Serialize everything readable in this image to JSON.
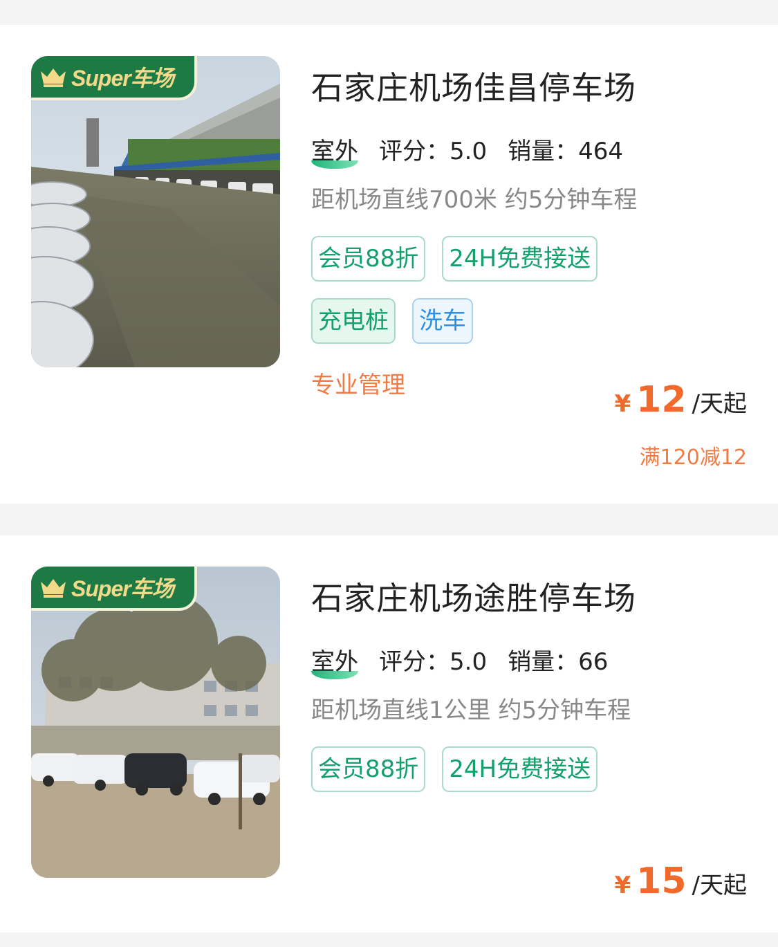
{
  "badge": {
    "text": "Super车场",
    "icon": "crown-icon",
    "bg_color": "#1e7a45",
    "text_color": "#f3d98a"
  },
  "accent_color": "#f26a2b",
  "lots": [
    {
      "title": "石家庄机场佳昌停车场",
      "location_type": "室外",
      "rating_label": "评分：5.0",
      "sales_label": "销量：464",
      "distance": "距机场直线700米 约5分钟车程",
      "tags": [
        "会员88折",
        "24H免费接送",
        "充电桩",
        "洗车"
      ],
      "feature": "专业管理",
      "price_symbol": "¥",
      "price": "12",
      "price_unit": "/天起",
      "discount": "满120减12"
    },
    {
      "title": "石家庄机场途胜停车场",
      "location_type": "室外",
      "rating_label": "评分：5.0",
      "sales_label": "销量：66",
      "distance": "距机场直线1公里 约5分钟车程",
      "tags": [
        "会员88折",
        "24H免费接送"
      ],
      "price_symbol": "¥",
      "price": "15",
      "price_unit": "/天起"
    }
  ]
}
